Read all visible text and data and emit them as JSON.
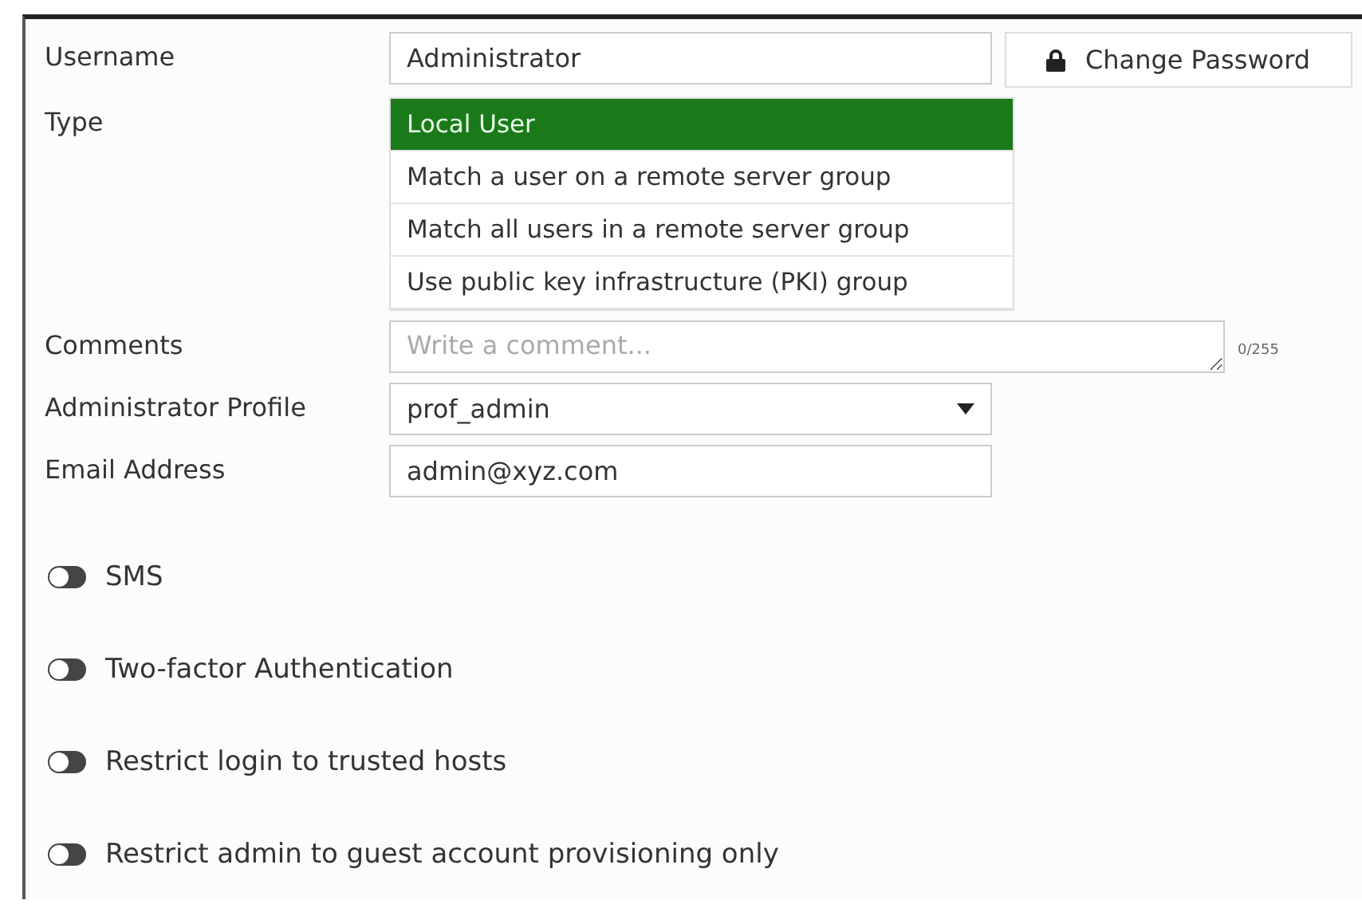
{
  "form": {
    "fields": [
      {
        "kind": "text",
        "label": "Username",
        "value": "Administrator"
      },
      {
        "kind": "list",
        "label": "Type",
        "options": [
          {
            "label": "Local User",
            "selected": true
          },
          {
            "label": "Match a user on a remote server group",
            "selected": false
          },
          {
            "label": "Match all users in a remote server group",
            "selected": false
          },
          {
            "label": "Use public key infrastructure (PKI) group",
            "selected": false
          }
        ]
      },
      {
        "kind": "textarea",
        "label": "Comments",
        "placeholder": "Write a comment...",
        "counter": "0/255"
      },
      {
        "kind": "select",
        "label": "Administrator Profile",
        "value": "prof_admin"
      },
      {
        "kind": "text",
        "label": "Email Address",
        "value": "admin@xyz.com"
      }
    ],
    "change_password": "Change Password",
    "toggles": [
      {
        "label": "SMS",
        "on": false
      },
      {
        "label": "Two-factor Authentication",
        "on": false
      },
      {
        "label": "Restrict login to trusted hosts",
        "on": false
      },
      {
        "label": "Restrict admin to guest account provisioning only",
        "on": false
      }
    ]
  }
}
